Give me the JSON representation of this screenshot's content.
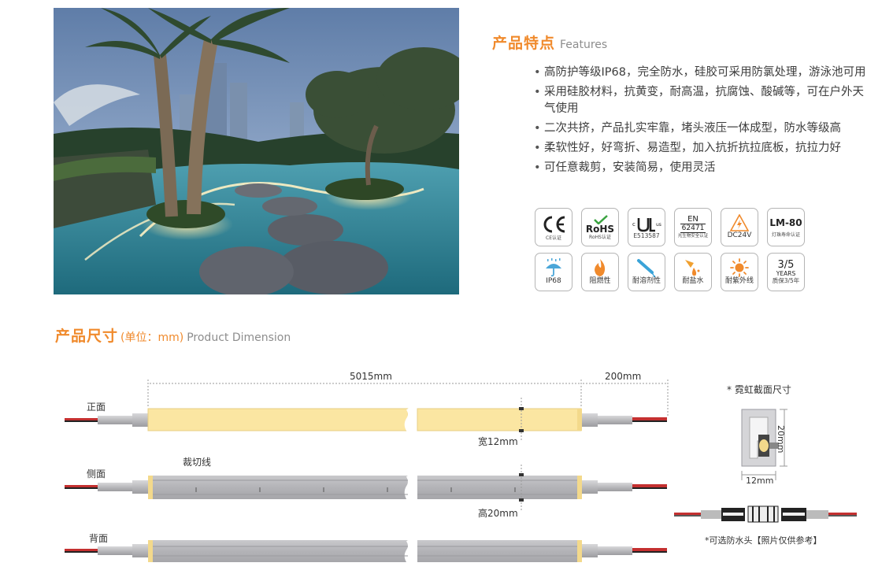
{
  "features": {
    "title": "产品特点",
    "title_en": "Features",
    "items": [
      "高防护等级IP68，完全防水，硅胶可采用防氯处理，游泳池可用",
      "采用硅胶材料，抗黄变，耐高温，抗腐蚀、酸碱等，可在户外天气使用",
      "二次共挤，产品扎实牢靠，堵头液压一体成型，防水等级高",
      "柔软性好，好弯折、易造型，加入抗折抗拉底板，抗拉力好",
      "可任意裁剪，安装简易，使用灵活"
    ]
  },
  "badges": {
    "ce": {
      "caption": "CE认证",
      "icon": "ce-icon"
    },
    "rohs": {
      "caption": "RoHS认证",
      "mark": "RoHS",
      "icon": "rohs-icon"
    },
    "ul": {
      "caption": "E513587",
      "icon": "ul-icon"
    },
    "en": {
      "line1": "EN",
      "line2": "62471",
      "caption": "光生物安全认证"
    },
    "dc": {
      "caption": "DC24V",
      "icon": "high-voltage-icon"
    },
    "lm": {
      "line1": "LM-80",
      "caption": "灯珠寿命认证"
    },
    "ip": {
      "caption": "IP68",
      "icon": "umbrella-rain-icon"
    },
    "fire": {
      "caption": "阻燃性",
      "icon": "flame-icon"
    },
    "solvent": {
      "caption": "耐溶剂性",
      "icon": "solvent-icon"
    },
    "salt": {
      "caption": "耐盐水",
      "icon": "salt-water-icon"
    },
    "uv": {
      "caption": "耐紫外线",
      "icon": "sun-icon"
    },
    "warranty": {
      "line1": "3/5",
      "line2": "YEARS",
      "caption": "质保3/5年"
    }
  },
  "dimension": {
    "title": "产品尺寸",
    "unit": "(单位：mm)",
    "title_en": "Product Dimension",
    "length_label": "5015mm",
    "lead_label": "200mm",
    "front_label": "正面",
    "side_label": "侧面",
    "back_label": "背面",
    "cut_line_label": "裁切线",
    "width_label": "宽12mm",
    "height_label": "高20mm",
    "cross_section_title": "* 霓虹截面尺寸",
    "cs_height": "20mm",
    "cs_width": "12mm",
    "connector_caption": "*可选防水头【照片仅供参考】"
  },
  "colors": {
    "accent": "#f08a2c",
    "light_face": "#fbe6a2",
    "profile_gray": "#b9b9bd"
  }
}
